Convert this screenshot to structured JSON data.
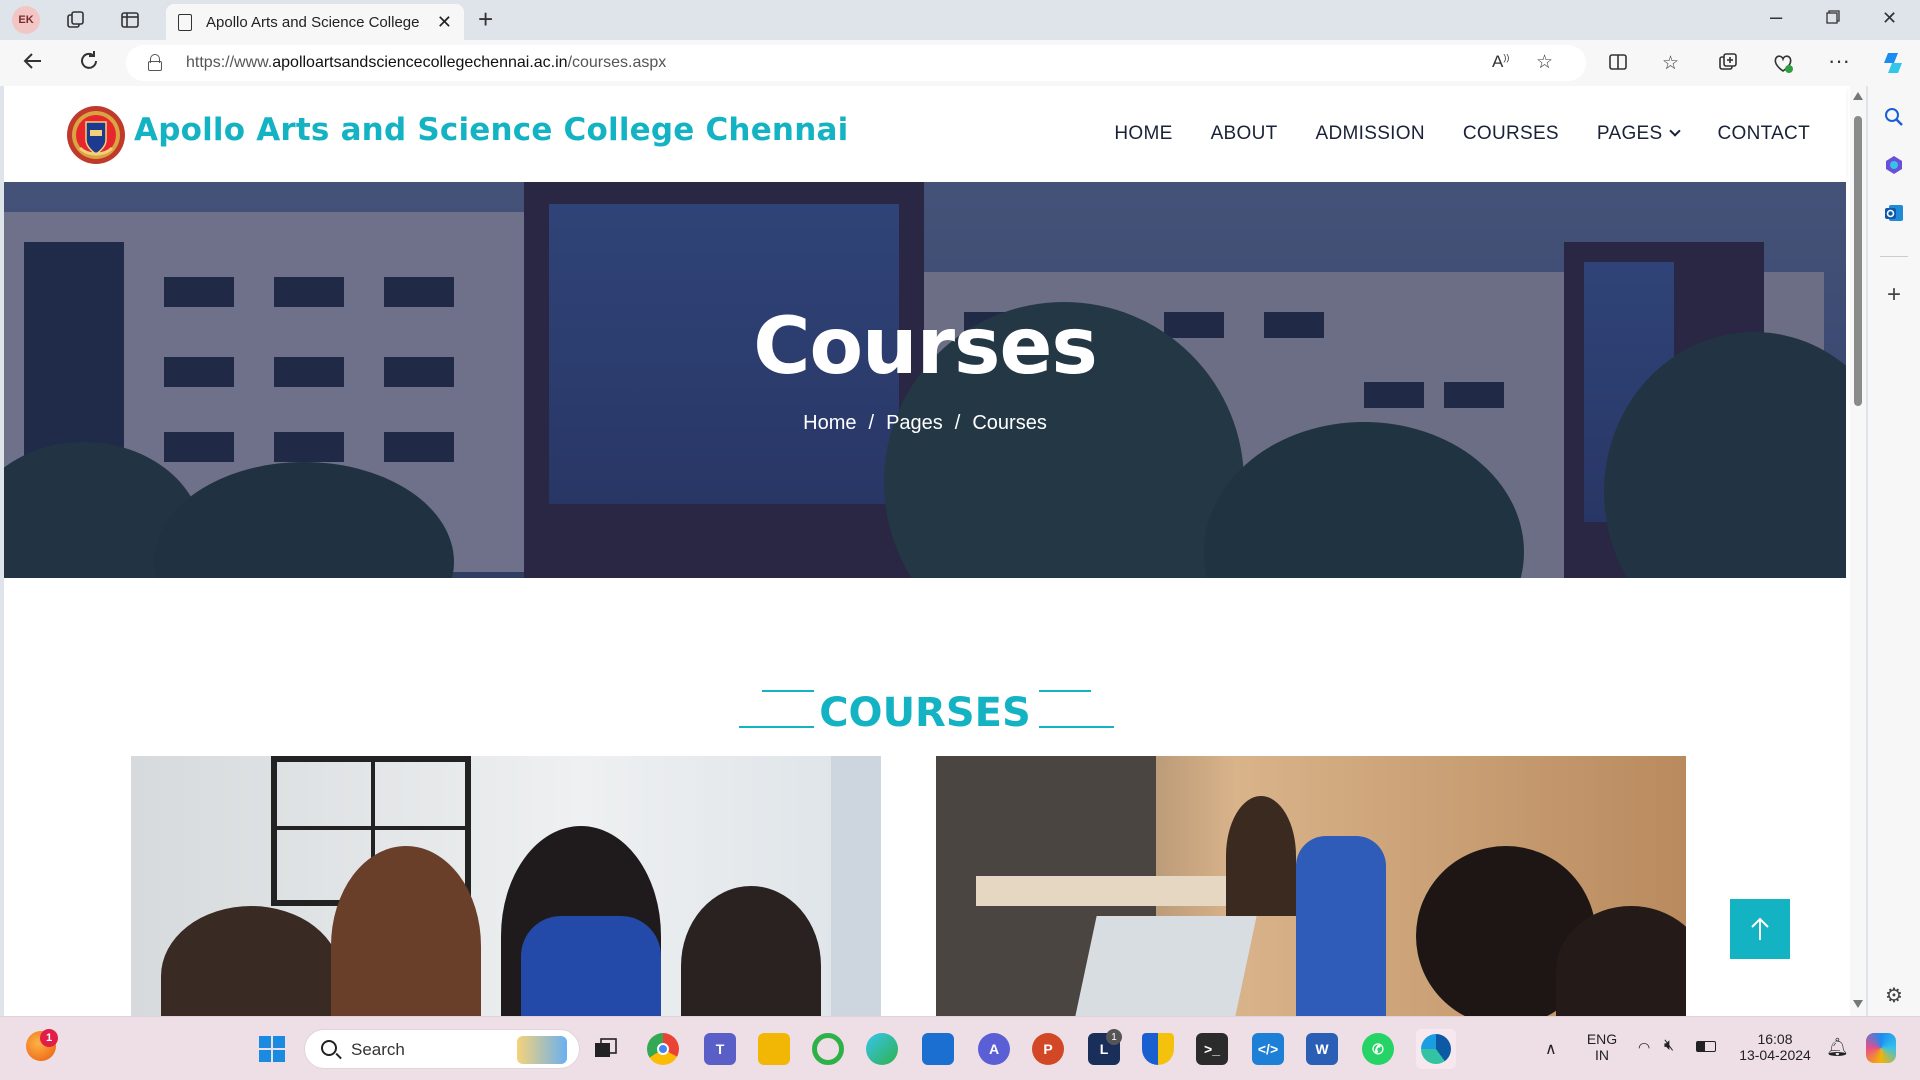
{
  "browser": {
    "profile_initials": "EK",
    "tab_title": "Apollo Arts and Science College",
    "url_prefix": "https://www.",
    "url_domain": "apolloartsandsciencecollegechennai.ac.in",
    "url_path": "/courses.aspx"
  },
  "site": {
    "title": "Apollo Arts and Science College Chennai",
    "brand_color": "#14b3c4",
    "nav": [
      "HOME",
      "ABOUT",
      "ADMISSION",
      "COURSES",
      "PAGES",
      "CONTACT"
    ]
  },
  "hero": {
    "title": "Courses",
    "breadcrumb": [
      "Home",
      "Pages",
      "Courses"
    ]
  },
  "section": {
    "title": "COURSES"
  },
  "taskbar": {
    "search_label": "Search",
    "lang_line1": "ENG",
    "lang_line2": "IN",
    "time": "16:08",
    "date": "13-04-2024",
    "notification_count": "1",
    "app_badge": "1"
  }
}
